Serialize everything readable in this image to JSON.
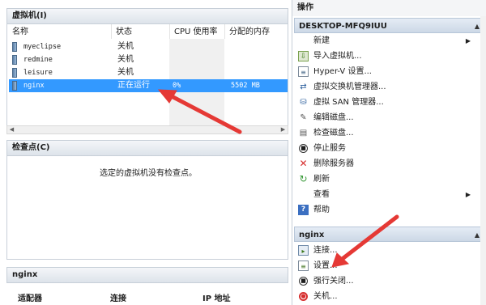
{
  "vm_panel": {
    "title": "虚拟机(I)",
    "columns": [
      "名称",
      "状态",
      "CPU 使用率",
      "分配的内存"
    ],
    "rows": [
      {
        "name": "myeclipse",
        "state": "关机",
        "cpu": "",
        "memory": ""
      },
      {
        "name": "redmine",
        "state": "关机",
        "cpu": "",
        "memory": ""
      },
      {
        "name": "leisure",
        "state": "关机",
        "cpu": "",
        "memory": ""
      },
      {
        "name": "nginx",
        "state": "正在运行",
        "cpu": "0%",
        "memory": "5502 MB"
      }
    ],
    "selected_row": 3
  },
  "checkpoint_panel": {
    "title": "检查点(C)",
    "empty_message": "选定的虚拟机没有检查点。"
  },
  "nginx_panel": {
    "title": "nginx",
    "columns": [
      "适配器",
      "连接",
      "IP 地址"
    ]
  },
  "actions_pane": {
    "title": "操作",
    "host_group": {
      "title": "DESKTOP-MFQ9IUU",
      "items": [
        {
          "label": "新建",
          "icon": "blank",
          "submenu": true
        },
        {
          "label": "导入虚拟机...",
          "icon": "import-icon"
        },
        {
          "label": "Hyper-V 设置...",
          "icon": "settings-doc-icon"
        },
        {
          "label": "虚拟交换机管理器...",
          "icon": "switch-icon"
        },
        {
          "label": "虚拟 SAN 管理器...",
          "icon": "san-icon"
        },
        {
          "label": "编辑磁盘...",
          "icon": "edit-disk-icon"
        },
        {
          "label": "检查磁盘...",
          "icon": "inspect-disk-icon"
        },
        {
          "label": "停止服务",
          "icon": "stop-icon"
        },
        {
          "label": "删除服务器",
          "icon": "delete-icon"
        },
        {
          "label": "刷新",
          "icon": "refresh-icon"
        },
        {
          "label": "查看",
          "icon": "blank",
          "submenu": true
        },
        {
          "label": "帮助",
          "icon": "help-icon"
        }
      ]
    },
    "vm_group": {
      "title": "nginx",
      "items": [
        {
          "label": "连接...",
          "icon": "connect-icon"
        },
        {
          "label": "设置...",
          "icon": "settings-icon"
        },
        {
          "label": "强行关闭...",
          "icon": "turn-off-icon"
        },
        {
          "label": "关机...",
          "icon": "shutdown-icon"
        }
      ]
    }
  },
  "colors": {
    "selection": "#3399ff",
    "annotation_arrow": "#e53935"
  }
}
